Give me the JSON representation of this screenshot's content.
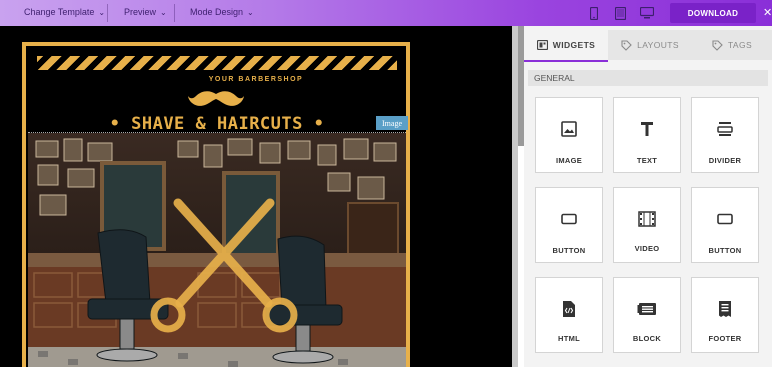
{
  "toolbar": {
    "change_template": "Change Template",
    "preview": "Preview",
    "mode_design": "Mode Design",
    "download": "DOWNLOAD",
    "devices": [
      "mobile-icon",
      "tablet-icon",
      "desktop-icon"
    ],
    "close": "✕"
  },
  "canvas": {
    "shop_name": "YOUR BARBERSHOP",
    "headline": "• SHAVE & HAIRCUTS •",
    "selection_tag": "Image",
    "accent": "#e7b04a"
  },
  "panel": {
    "tabs": [
      {
        "label": "WIDGETS",
        "icon": "widgets-icon"
      },
      {
        "label": "LAYOUTS",
        "icon": "layouts-tag-icon"
      },
      {
        "label": "TAGS",
        "icon": "tags-icon"
      }
    ],
    "section": "GENERAL",
    "widgets": [
      {
        "label": "IMAGE",
        "icon": "image-icon"
      },
      {
        "label": "TEXT",
        "icon": "text-icon"
      },
      {
        "label": "DIVIDER",
        "icon": "divider-icon"
      },
      {
        "label": "BUTTON",
        "icon": "button-icon"
      },
      {
        "label": "VIDEO",
        "icon": "video-icon"
      },
      {
        "label": "BUTTON",
        "icon": "button-icon"
      },
      {
        "label": "HTML",
        "icon": "html-icon"
      },
      {
        "label": "BLOCK",
        "icon": "block-icon"
      },
      {
        "label": "FOOTER",
        "icon": "footer-icon"
      }
    ]
  },
  "colors": {
    "brand": "#8a2fd8",
    "download_bg": "#7a22c8"
  }
}
